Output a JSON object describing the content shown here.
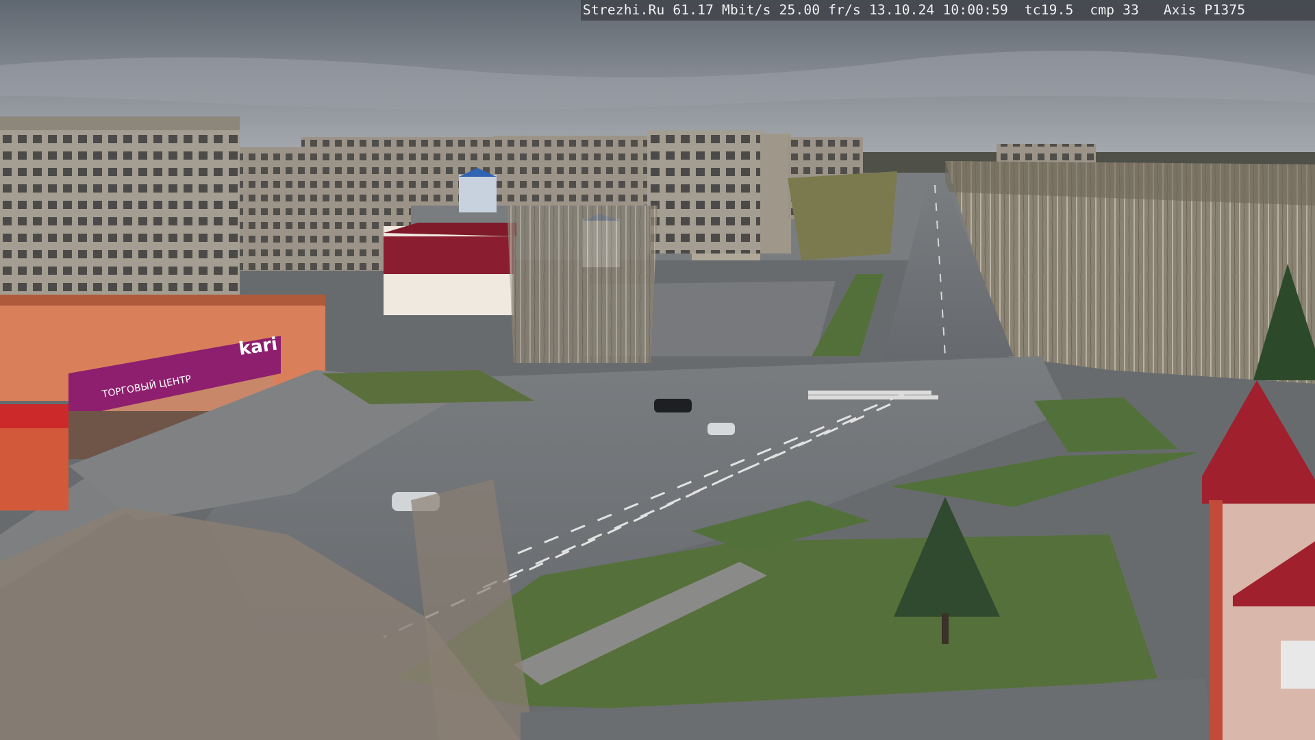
{
  "camera_overlay": {
    "site": "Strezhi.Ru",
    "bitrate": "61.17 Mbit/s",
    "framerate": "25.00 fr/s",
    "date": "13.10.24",
    "time": "10:00:59",
    "tc": "tc19.5",
    "cmp": "cmp 33",
    "model": "Axis P1375"
  },
  "signage": {
    "store_logo": "kari",
    "store_banner": "ТОРГОВЫЙ ЦЕНТР"
  },
  "colors": {
    "sky_top": "#5f6770",
    "sky_horizon": "#a9adb3",
    "asphalt": "#6f7276",
    "grass": "#55703a",
    "store_magenta": "#8e1f6e",
    "roof_red": "#a0202e"
  }
}
